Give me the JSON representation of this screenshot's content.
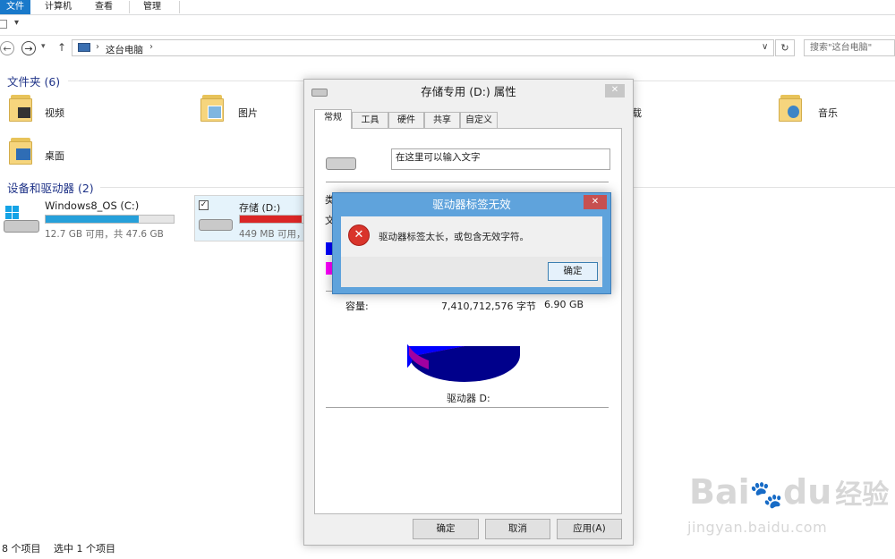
{
  "ribbon": {
    "tabs": [
      {
        "label": "文件"
      },
      {
        "label": "计算机"
      },
      {
        "label": "查看"
      },
      {
        "label": "管理"
      }
    ]
  },
  "qat": {
    "overflow_glyph": "▾"
  },
  "nav": {
    "back_glyph": "←",
    "forward_glyph": "→",
    "history_glyph": "▾",
    "up_glyph": "↑",
    "dropdown_glyph": "∨",
    "refresh_glyph": "↻"
  },
  "address": {
    "separator": "›",
    "location": "这台电脑",
    "search_placeholder": "搜索\"这台电脑\""
  },
  "folders": {
    "title": "文件夹 (6)",
    "items": [
      {
        "label": "视频"
      },
      {
        "label": "图片"
      },
      {
        "label": "载"
      },
      {
        "label": "音乐"
      },
      {
        "label": "桌面"
      }
    ]
  },
  "devices": {
    "title": "设备和驱动器 (2)",
    "drives": [
      {
        "name": "Windows8_OS (C:)",
        "info": "12.7 GB 可用，共 47.6 GB",
        "used_fraction": 0.73,
        "bar_color": "#26a0da"
      },
      {
        "name": "存储 (D:)",
        "info": "449 MB 可用，",
        "used_fraction": 0.94,
        "bar_color": "#da2626",
        "checked": true
      }
    ]
  },
  "statusbar": {
    "count": "8 个项目",
    "selected": "选中 1 个项目"
  },
  "props": {
    "title": "存储专用 (D:) 属性",
    "close": "✕",
    "tabs": [
      {
        "label": "常规"
      },
      {
        "label": "工具"
      },
      {
        "label": "硬件"
      },
      {
        "label": "共享"
      },
      {
        "label": "自定义"
      }
    ],
    "label_value": "在这里可以输入文字",
    "partial_labels": [
      "类",
      "文"
    ],
    "capacity": {
      "label": "容量:",
      "bytes": "7,410,712,576 字节",
      "size": "6.90 GB"
    },
    "pie": {
      "used_fraction": 0.94,
      "used_color": "#0000ff",
      "free_color": "#ff00ff"
    },
    "drive_label": "驱动器 D:",
    "buttons": {
      "ok": "确定",
      "cancel": "取消",
      "apply": "应用(A)"
    }
  },
  "error": {
    "title": "驱动器标签无效",
    "close": "✕",
    "icon_glyph": "✕",
    "message": "驱动器标签太长，或包含无效字符。",
    "ok": "确定"
  },
  "watermark": {
    "text": "Bai",
    "paw": "🐾",
    "text2": "du",
    "cn": "经验",
    "url": "jingyan.baidu.com"
  }
}
